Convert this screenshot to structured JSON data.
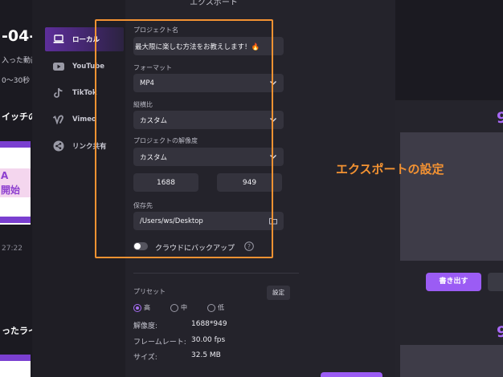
{
  "dialog": {
    "title": "エクスポート"
  },
  "sidebar": {
    "items": [
      {
        "label": "ローカル",
        "icon": "laptop-icon",
        "active": true
      },
      {
        "label": "YouTube",
        "icon": "youtube-icon",
        "active": false
      },
      {
        "label": "TikTok",
        "icon": "tiktok-icon",
        "active": false
      },
      {
        "label": "Vimeo",
        "icon": "vimeo-icon",
        "active": false
      },
      {
        "label": "リンク共有",
        "icon": "link-share-icon",
        "active": false
      }
    ]
  },
  "form": {
    "project_name": {
      "label": "プロジェクト名",
      "value": "最大限に楽しむ方法をお教えします！🔥"
    },
    "format": {
      "label": "フォーマット",
      "value": "MP4"
    },
    "aspect_ratio": {
      "label": "縦横比",
      "value": "カスタム"
    },
    "resolution": {
      "label": "プロジェクトの解像度",
      "value": "カスタム",
      "width": "1688",
      "height": "949"
    },
    "save_location": {
      "label": "保存先",
      "value": "/Users/ws/Desktop"
    },
    "cloud_backup": {
      "label": "クラウドにバックアップ",
      "enabled": false
    }
  },
  "preset": {
    "label": "プリセット",
    "settings_button": "設定",
    "options": [
      {
        "label": "高",
        "selected": true
      },
      {
        "label": "中",
        "selected": false
      },
      {
        "label": "低",
        "selected": false
      }
    ],
    "info": [
      {
        "key": "解像度:",
        "value": "1688*949"
      },
      {
        "key": "フレームレート:",
        "value": "30.00 fps"
      },
      {
        "key": "サイズ:",
        "value": "32.5 MB"
      }
    ]
  },
  "annotation": "エクスポートの設定",
  "background": {
    "left": {
      "date": "-04-",
      "line1": "入った動画",
      "line2": "0〜30秒",
      "heading1": "イッチの",
      "thumb_text1": "A",
      "thumb_text2": "開始",
      "time": "27:22",
      "heading2": "ったライ"
    },
    "right": {
      "number1": "9",
      "export_button": "書き出す",
      "number2": "9"
    }
  },
  "colors": {
    "accent": "#9b5cf4",
    "highlight": "#f39232",
    "panel": "#24232b"
  }
}
